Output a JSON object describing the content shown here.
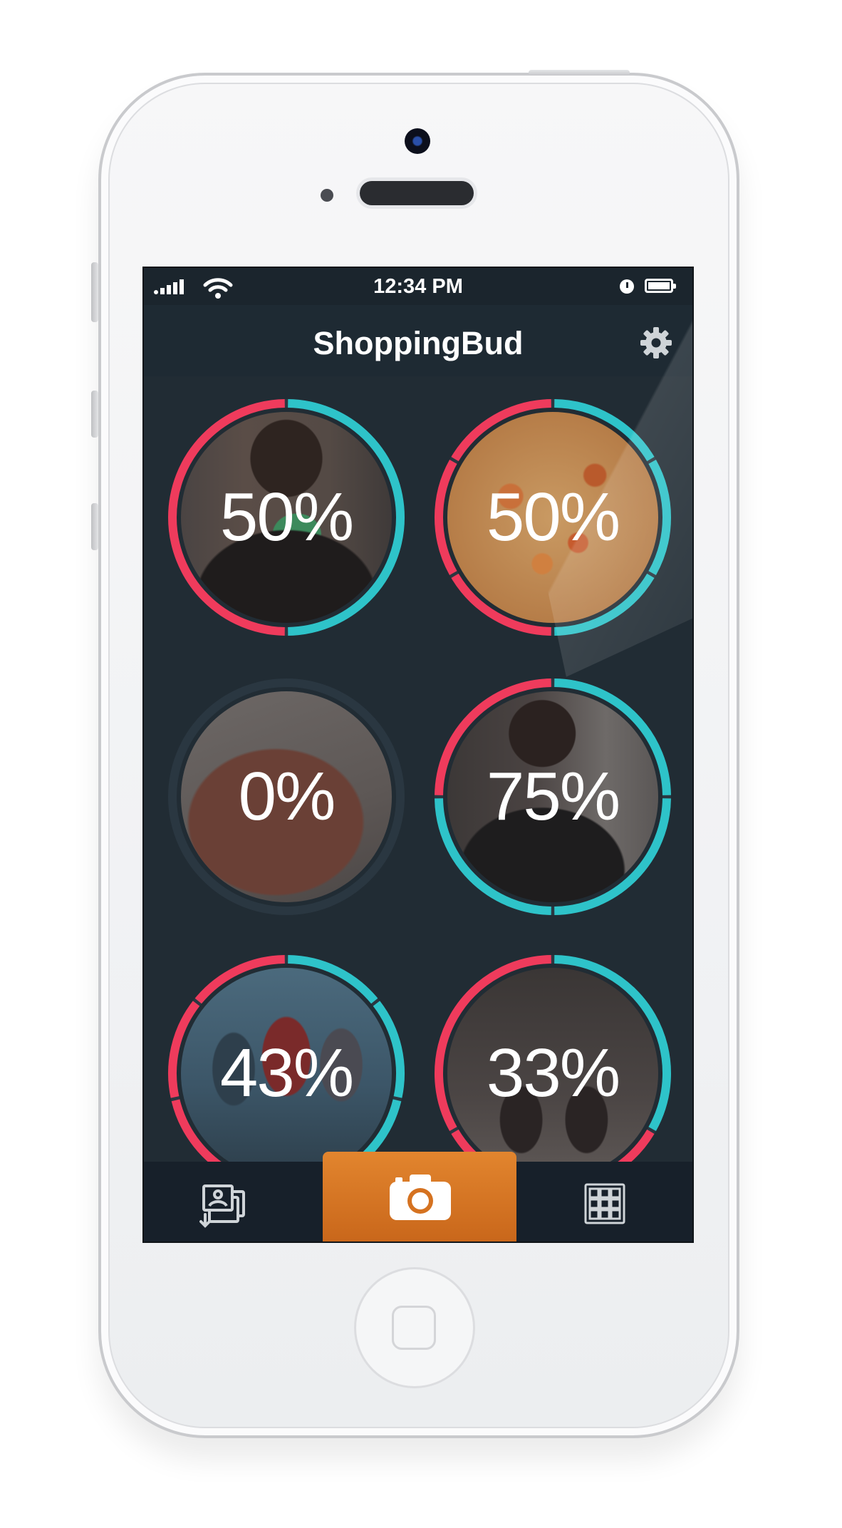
{
  "status_bar": {
    "time": "12:34 PM"
  },
  "nav": {
    "title": "ShoppingBud"
  },
  "icons": {
    "settings": "gear-icon",
    "gallery": "photo-stack-icon",
    "camera": "camera-icon",
    "grid": "grid-icon",
    "signal": "signal-icon",
    "wifi": "wifi-icon",
    "alarm": "alarm-icon",
    "battery": "battery-icon"
  },
  "colors": {
    "no": "#ef3b5c",
    "yes": "#2ec3c9",
    "camera_button": "#dd7c26",
    "background": "#212c34"
  },
  "tiles": [
    {
      "label": "50%",
      "yes_fraction": 0.5,
      "votes": 2,
      "photo": "person mirror selfie"
    },
    {
      "label": "50%",
      "yes_fraction": 0.5,
      "votes": 6,
      "photo": "pizza"
    },
    {
      "label": "0%",
      "yes_fraction": 0.0,
      "votes": 1,
      "photo": "brown leather handbag"
    },
    {
      "label": "75%",
      "yes_fraction": 0.75,
      "votes": 4,
      "photo": "person mirror selfie"
    },
    {
      "label": "43%",
      "yes_fraction": 0.43,
      "votes": 7,
      "photo": "movie poster"
    },
    {
      "label": "33%",
      "yes_fraction": 0.33,
      "votes": 3,
      "photo": "shoes on feet"
    }
  ]
}
